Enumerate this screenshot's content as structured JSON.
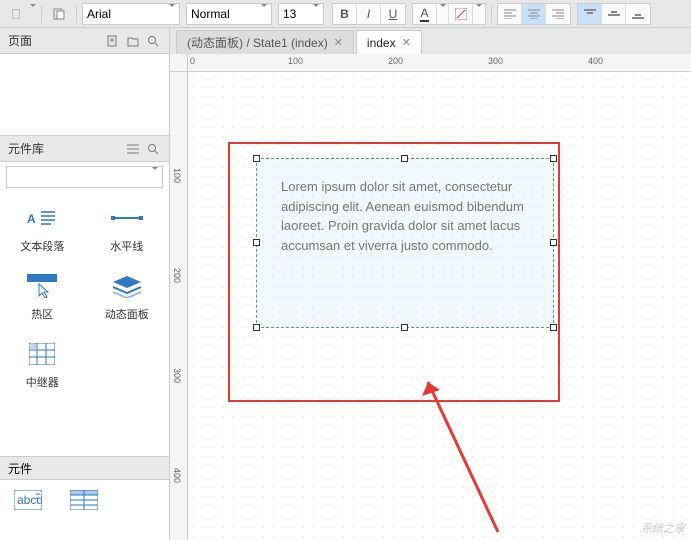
{
  "toolbar": {
    "font_family": "Arial",
    "font_style": "Normal",
    "font_size": "13"
  },
  "panels": {
    "pages": {
      "title": "页面"
    },
    "library": {
      "title": "元件库"
    },
    "elements": {
      "title": "元件"
    }
  },
  "widgets": [
    {
      "key": "text-paragraph",
      "label": "文本段落"
    },
    {
      "key": "horizontal-line",
      "label": "水平线"
    },
    {
      "key": "hotspot",
      "label": "热区"
    },
    {
      "key": "dynamic-panel",
      "label": "动态面板"
    },
    {
      "key": "repeater",
      "label": "中继器"
    }
  ],
  "tabs": [
    {
      "label": "(动态面板) / State1 (index)",
      "active": false
    },
    {
      "label": "index",
      "active": true
    }
  ],
  "ruler_marks_h": [
    "0",
    "100",
    "200",
    "300",
    "400"
  ],
  "ruler_marks_v": [
    "100",
    "200",
    "300",
    "400"
  ],
  "canvas": {
    "text_block": "Lorem ipsum dolor sit amet, consectetur adipiscing elit. Aenean euismod bibendum laoreet. Proin gravida dolor sit amet lacus accumsan et viverra justo commodo."
  },
  "watermark": "系统之家"
}
